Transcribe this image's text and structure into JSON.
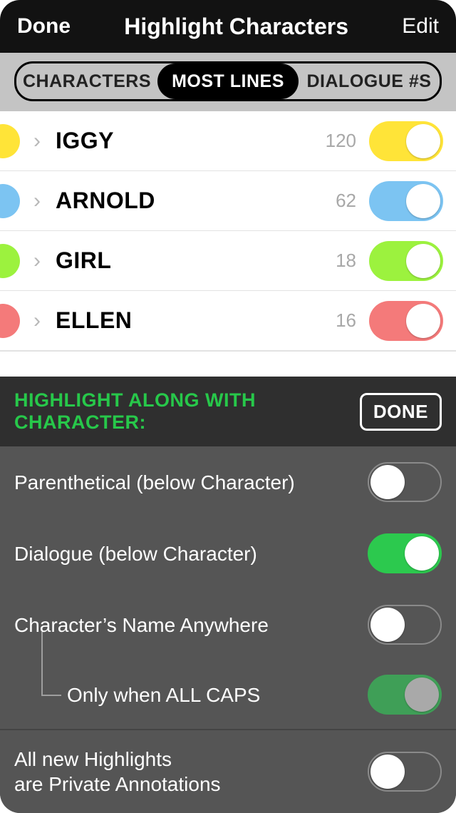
{
  "nav": {
    "done": "Done",
    "title": "Highlight Characters",
    "edit": "Edit"
  },
  "tabs": {
    "characters": "CHARACTERS",
    "most_lines": "MOST LINES",
    "dialogue_nums": "DIALOGUE #S"
  },
  "characters": [
    {
      "name": "IGGY",
      "count": "120",
      "color": "#ffe438",
      "toggle_color": "#ffe438"
    },
    {
      "name": "ARNOLD",
      "count": "62",
      "color": "#7cc4f2",
      "toggle_color": "#7cc4f2"
    },
    {
      "name": "GIRL",
      "count": "18",
      "color": "#9cf23e",
      "toggle_color": "#9cf23e"
    },
    {
      "name": "ELLEN",
      "count": "16",
      "color": "#f47a7a",
      "toggle_color": "#f47a7a"
    }
  ],
  "panel": {
    "header_label": "HIGHLIGHT ALONG WITH CHARACTER:",
    "done": "DONE",
    "parenthetical": "Parenthetical (below Character)",
    "dialogue": "Dialogue (below Character)",
    "name_anywhere": "Character’s Name Anywhere",
    "only_all_caps": "Only when ALL CAPS",
    "private_line1": "All new Highlights",
    "private_line2": "are Private Annotations"
  }
}
